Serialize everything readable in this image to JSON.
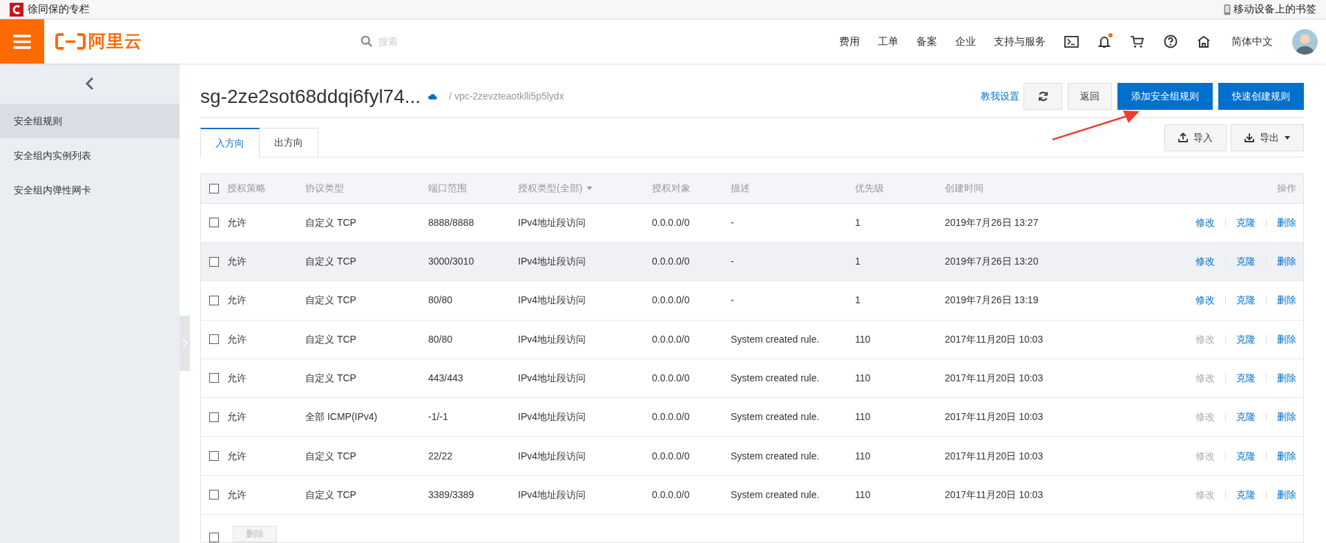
{
  "bookmark_bar": {
    "left": "徐同保的专栏",
    "right": "移动设备上的书签"
  },
  "nav": {
    "logo": "阿里云",
    "search": {
      "placeholder": "搜索"
    },
    "links": [
      "费用",
      "工单",
      "备案",
      "企业",
      "支持与服务"
    ],
    "notification_dot": true,
    "language": "简体中文"
  },
  "sidebar": {
    "items": [
      {
        "label": "安全组规则",
        "selected": true
      },
      {
        "label": "安全组内实例列表",
        "selected": false
      },
      {
        "label": "安全组内弹性网卡",
        "selected": false
      }
    ]
  },
  "header": {
    "title": "sg-2ze2sot68ddqi6fyl74...",
    "vpc": "/ vpc-2zevzteaotklli5p5lydx",
    "help_link": "教我设置",
    "buttons": [
      {
        "label": "返回",
        "kind": "default"
      },
      {
        "label": "添加安全组规则",
        "kind": "primary"
      },
      {
        "label": "快速创建规则",
        "kind": "primary"
      }
    ]
  },
  "tabs": [
    {
      "label": "入方向",
      "selected": true
    },
    {
      "label": "出方向",
      "selected": false
    }
  ],
  "tools": [
    {
      "label": "导入",
      "kind": "import"
    },
    {
      "label": "导出",
      "kind": "export"
    }
  ],
  "table": {
    "header_checked": false,
    "columns": [
      {
        "label": "授权策略",
        "kind": "plain"
      },
      {
        "label": "协议类型",
        "kind": "plain"
      },
      {
        "label": "端口范围",
        "kind": "plain"
      },
      {
        "label": "授权类型(全部)",
        "kind": "filter"
      },
      {
        "label": "授权对象",
        "kind": "plain"
      },
      {
        "label": "描述",
        "kind": "plain"
      },
      {
        "label": "优先级",
        "kind": "plain"
      },
      {
        "label": "创建时间",
        "kind": "plain"
      },
      {
        "label": "操作",
        "kind": "actions"
      }
    ],
    "rows": [
      {
        "checked": false,
        "highlighted": false,
        "cells": [
          "允许",
          "自定义 TCP",
          "8888/8888",
          "IPv4地址段访问",
          "0.0.0.0/0",
          "-",
          "1",
          "2019年7月26日 13:27"
        ],
        "actions": [
          {
            "label": "修改",
            "disabled": false
          },
          {
            "label": "克隆",
            "disabled": false
          },
          {
            "label": "删除",
            "disabled": false
          }
        ]
      },
      {
        "checked": false,
        "highlighted": true,
        "cells": [
          "允许",
          "自定义 TCP",
          "3000/3010",
          "IPv4地址段访问",
          "0.0.0.0/0",
          "-",
          "1",
          "2019年7月26日 13:20"
        ],
        "actions": [
          {
            "label": "修改",
            "disabled": false
          },
          {
            "label": "克隆",
            "disabled": false
          },
          {
            "label": "删除",
            "disabled": false
          }
        ]
      },
      {
        "checked": false,
        "highlighted": false,
        "cells": [
          "允许",
          "自定义 TCP",
          "80/80",
          "IPv4地址段访问",
          "0.0.0.0/0",
          "-",
          "1",
          "2019年7月26日 13:19"
        ],
        "actions": [
          {
            "label": "修改",
            "disabled": false
          },
          {
            "label": "克隆",
            "disabled": false
          },
          {
            "label": "删除",
            "disabled": false
          }
        ]
      },
      {
        "checked": false,
        "highlighted": false,
        "cells": [
          "允许",
          "自定义 TCP",
          "80/80",
          "IPv4地址段访问",
          "0.0.0.0/0",
          "System created rule.",
          "110",
          "2017年11月20日 10:03"
        ],
        "actions": [
          {
            "label": "修改",
            "disabled": true
          },
          {
            "label": "克隆",
            "disabled": false
          },
          {
            "label": "删除",
            "disabled": false
          }
        ]
      },
      {
        "checked": false,
        "highlighted": false,
        "cells": [
          "允许",
          "自定义 TCP",
          "443/443",
          "IPv4地址段访问",
          "0.0.0.0/0",
          "System created rule.",
          "110",
          "2017年11月20日 10:03"
        ],
        "actions": [
          {
            "label": "修改",
            "disabled": true
          },
          {
            "label": "克隆",
            "disabled": false
          },
          {
            "label": "删除",
            "disabled": false
          }
        ]
      },
      {
        "checked": false,
        "highlighted": false,
        "cells": [
          "允许",
          "全部 ICMP(IPv4)",
          "-1/-1",
          "IPv4地址段访问",
          "0.0.0.0/0",
          "System created rule.",
          "110",
          "2017年11月20日 10:03"
        ],
        "actions": [
          {
            "label": "修改",
            "disabled": true
          },
          {
            "label": "克隆",
            "disabled": false
          },
          {
            "label": "删除",
            "disabled": false
          }
        ]
      },
      {
        "checked": false,
        "highlighted": false,
        "cells": [
          "允许",
          "自定义 TCP",
          "22/22",
          "IPv4地址段访问",
          "0.0.0.0/0",
          "System created rule.",
          "110",
          "2017年11月20日 10:03"
        ],
        "actions": [
          {
            "label": "修改",
            "disabled": true
          },
          {
            "label": "克隆",
            "disabled": false
          },
          {
            "label": "删除",
            "disabled": false
          }
        ]
      },
      {
        "checked": false,
        "highlighted": false,
        "cells": [
          "允许",
          "自定义 TCP",
          "3389/3389",
          "IPv4地址段访问",
          "0.0.0.0/0",
          "System created rule.",
          "110",
          "2017年11月20日 10:03"
        ],
        "actions": [
          {
            "label": "修改",
            "disabled": true
          },
          {
            "label": "克隆",
            "disabled": false
          },
          {
            "label": "删除",
            "disabled": false
          }
        ]
      }
    ]
  },
  "footer": {
    "checked": false,
    "delete_button": {
      "label": "删除",
      "disabled": true
    }
  }
}
